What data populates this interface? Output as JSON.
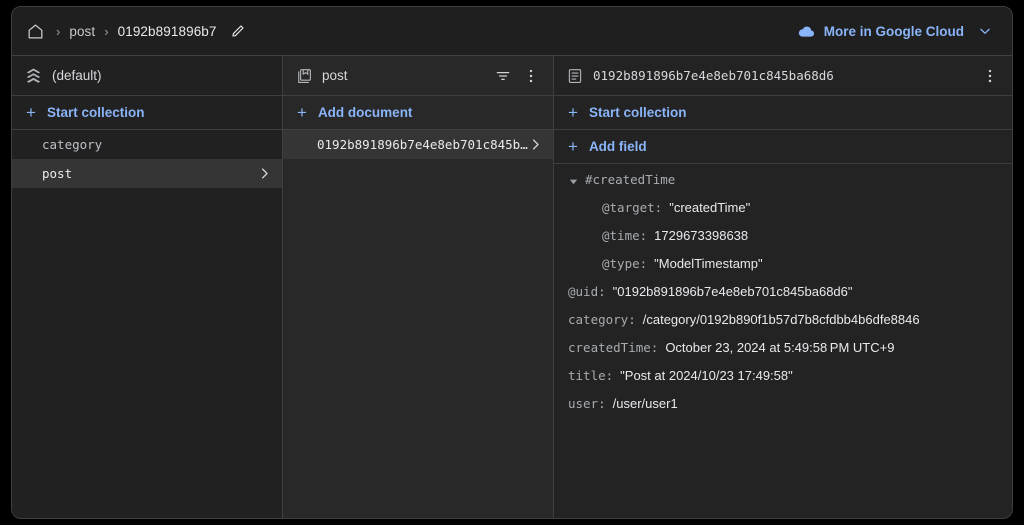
{
  "topbar": {
    "home_icon": "home-icon",
    "breadcrumbs": [
      {
        "label": "post"
      },
      {
        "label": "0192b891896b7"
      }
    ],
    "separator": "›",
    "edit_icon": "pencil-icon",
    "more_in_cloud": {
      "label": "More in Google Cloud",
      "cloud_icon": "cloud-icon",
      "chevron_icon": "chevron-down-icon",
      "accent_color": "#8ab4f8"
    }
  },
  "panel_database": {
    "icon": "firestore-database-icon",
    "title": "(default)",
    "action": {
      "plus": "+",
      "label": "Start collection"
    },
    "items": [
      {
        "label": "category",
        "selected": false
      },
      {
        "label": "post",
        "selected": true
      }
    ]
  },
  "panel_collection": {
    "icon": "collection-icon",
    "title": "post",
    "filter_icon": "filter-icon",
    "overflow_icon": "more-vert-icon",
    "action": {
      "plus": "+",
      "label": "Add document"
    },
    "items": [
      {
        "label": "0192b891896b7e4e8eb701c845b…",
        "selected": true
      }
    ]
  },
  "panel_document": {
    "icon": "document-icon",
    "title": "0192b891896b7e4e8eb701c845ba68d6",
    "overflow_icon": "more-vert-icon",
    "action_start_collection": {
      "plus": "+",
      "label": "Start collection"
    },
    "action_add_field": {
      "plus": "+",
      "label": "Add field"
    },
    "fields": [
      {
        "indent": 0,
        "twisty": true,
        "key": "#createdTime",
        "value": ""
      },
      {
        "indent": 1,
        "twisty": false,
        "key": "@target:",
        "value": "\"createdTime\""
      },
      {
        "indent": 1,
        "twisty": false,
        "key": "@time:",
        "value": "1729673398638"
      },
      {
        "indent": 1,
        "twisty": false,
        "key": "@type:",
        "value": "\"ModelTimestamp\""
      },
      {
        "indent": 0,
        "twisty": false,
        "key": "@uid:",
        "value": "\"0192b891896b7e4e8eb701c845ba68d6\""
      },
      {
        "indent": 0,
        "twisty": false,
        "key": "category:",
        "value": "/category/0192b890f1b57d7b8cfdbb4b6dfe8846"
      },
      {
        "indent": 0,
        "twisty": false,
        "key": "createdTime:",
        "value": "October 23, 2024 at 5:49:58 PM UTC+9"
      },
      {
        "indent": 0,
        "twisty": false,
        "key": "title:",
        "value": "\"Post at 2024/10/23 17:49:58\""
      },
      {
        "indent": 0,
        "twisty": false,
        "key": "user:",
        "value": "/user/user1"
      }
    ]
  }
}
